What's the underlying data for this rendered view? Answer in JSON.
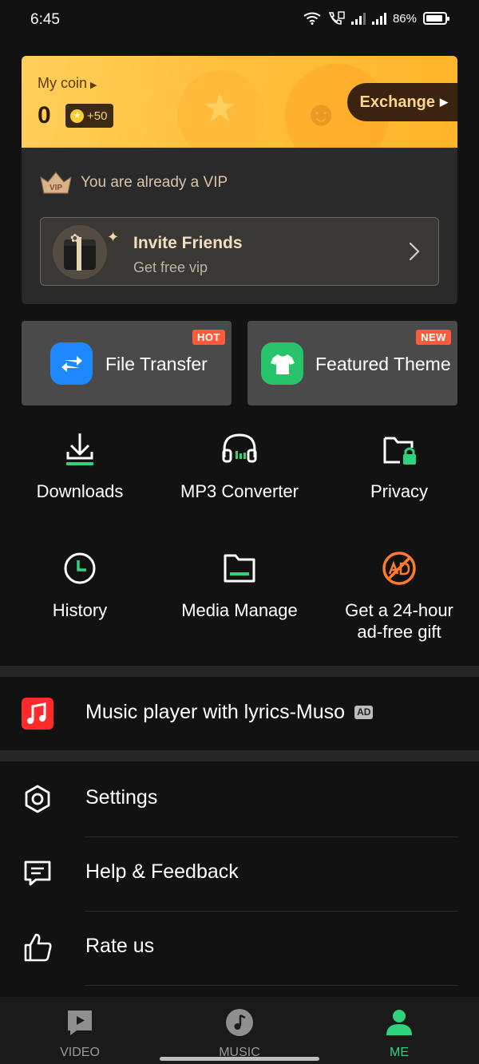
{
  "status_bar": {
    "time": "6:45",
    "battery": "86%"
  },
  "coins": {
    "label": "My coin",
    "value": "0",
    "bonus": "+50",
    "exchange_label": "Exchange"
  },
  "vip": {
    "crown_text": "VIP",
    "status": "You are already a VIP",
    "invite_title": "Invite Friends",
    "invite_subtitle": "Get free vip"
  },
  "features": [
    {
      "label": "File Transfer",
      "tag": "HOT",
      "icon": "transfer-icon",
      "color": "#1e88ff"
    },
    {
      "label": "Featured Theme",
      "tag": "NEW",
      "icon": "shirt-icon",
      "color": "#27c46b"
    }
  ],
  "tools": [
    {
      "label": "Downloads",
      "icon": "download-icon"
    },
    {
      "label": "MP3 Converter",
      "icon": "headphones-icon"
    },
    {
      "label": "Privacy",
      "icon": "private-folder-icon"
    },
    {
      "label": "History",
      "icon": "clock-icon"
    },
    {
      "label": "Media Manage",
      "icon": "folder-icon"
    },
    {
      "label": "Get a 24-hour ad-free gift",
      "label_line1": "Get a 24-hour",
      "label_line2": "ad-free gift",
      "icon": "no-ads-icon"
    }
  ],
  "promo": {
    "label": "Music player with lyrics-Muso",
    "badge": "AD",
    "icon": "music-note-icon"
  },
  "menu": [
    {
      "label": "Settings",
      "icon": "settings-icon"
    },
    {
      "label": "Help & Feedback",
      "icon": "feedback-icon"
    },
    {
      "label": "Rate us",
      "icon": "thumbs-up-icon"
    }
  ],
  "nav": [
    {
      "label": "VIDEO",
      "icon": "video-icon",
      "active": false
    },
    {
      "label": "MUSIC",
      "icon": "music-icon",
      "active": false
    },
    {
      "label": "ME",
      "icon": "person-icon",
      "active": true
    }
  ],
  "colors": {
    "accent_green": "#2fd27d",
    "hot_tag": "#ff5a3c",
    "coin_gold": "#ffc13d",
    "background": "#121212"
  }
}
